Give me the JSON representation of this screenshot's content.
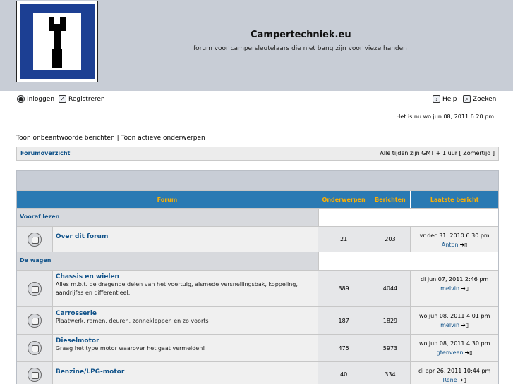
{
  "site": {
    "title": "Campertechniek.eu",
    "description": "forum voor campersleutelaars die niet bang zijn voor vieze handen"
  },
  "toplinks": {
    "login": "Inloggen",
    "register": "Registreren",
    "help": "Help",
    "search": "Zoeken"
  },
  "time_info": "Het is nu wo jun 08, 2011 6:20 pm",
  "actions": {
    "unanswered": "Toon onbeantwoorde berichten",
    "separator": "|",
    "active": "Toon actieve onderwerpen"
  },
  "navbar": {
    "forum_index": "Forumoverzicht",
    "timezone": "Alle tijden zijn GMT + 1 uur [ Zomertijd ]"
  },
  "table": {
    "headers": {
      "forum": "Forum",
      "topics": "Onderwerpen",
      "posts": "Berichten",
      "last_post": "Laatste bericht"
    },
    "categories": [
      {
        "name": "Vooraf lezen",
        "forums": [
          {
            "name": "Over dit forum",
            "desc": "",
            "topics": "21",
            "posts": "203",
            "last_date": "vr dec 31, 2010 6:30 pm",
            "last_author": "Anton"
          }
        ]
      },
      {
        "name": "De wagen",
        "forums": [
          {
            "name": "Chassis en wielen",
            "desc": "Alles m.b.t. de dragende delen van het voertuig, alsmede versnellingsbak, koppeling, aandrijfas en differentieel.",
            "topics": "389",
            "posts": "4044",
            "last_date": "di jun 07, 2011 2:46 pm",
            "last_author": "melvin"
          },
          {
            "name": "Carrosserie",
            "desc": "Plaatwerk, ramen, deuren, zonnekleppen en zo voorts",
            "topics": "187",
            "posts": "1829",
            "last_date": "wo jun 08, 2011 4:01 pm",
            "last_author": "melvin"
          },
          {
            "name": "Dieselmotor",
            "desc": "Graag het type motor waarover het gaat vermelden!",
            "topics": "475",
            "posts": "5973",
            "last_date": "wo jun 08, 2011 4:30 pm",
            "last_author": "gtenveen"
          },
          {
            "name": "Benzine/LPG-motor",
            "desc": "",
            "topics": "40",
            "posts": "334",
            "last_date": "di apr 26, 2011 10:44 pm",
            "last_author": "Rene"
          }
        ]
      }
    ]
  },
  "colors": {
    "header_bg": "#c8cdd6",
    "table_header_bg": "#2a7ab3",
    "table_header_text": "#ffb000",
    "link": "#105289",
    "sign_blue": "#1c3f93"
  },
  "icons": {
    "login": "login-icon",
    "register": "register-icon",
    "help": "help-icon",
    "search": "search-icon",
    "forum_read": "forum-read-icon",
    "goto_last": "goto-last-post-icon"
  }
}
